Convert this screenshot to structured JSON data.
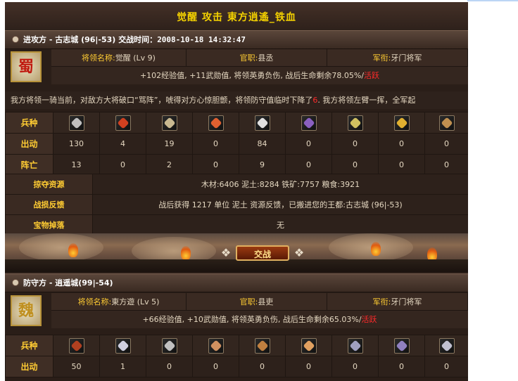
{
  "title": "觉醒 攻击 東方逍遙_铁血",
  "attacker": {
    "role": "进攻方",
    "city": "古志城 (96|-53)",
    "time_label": "交战时间：",
    "time": "2008-10-18 14:32:47",
    "general_label": "将领名称:",
    "general_name": "觉醒 (Lv 9)",
    "office_label": "官职:",
    "office": "县丞",
    "rank_label": "军衔:",
    "rank": "牙门将军",
    "avatar_glyph": "蜀",
    "result_text": "+102经验值, +11武勋值, 将领英勇负伤, 战后生命剩余78.05%/",
    "result_status": "活跃",
    "battle_text_1": "我方将领一骑当前，对敌方大将破口“骂阵”，唬得对方心惊胆颤，将领防守值临时下降了",
    "battle_text_red": "6",
    "battle_text_2": ". 我方将领左臂一挥，全军起",
    "units_label": "兵种",
    "sent_label": "出动",
    "lost_label": "阵亡",
    "sent": [
      "130",
      "4",
      "19",
      "0",
      "84",
      "0",
      "0",
      "0",
      "0"
    ],
    "lost": [
      "13",
      "0",
      "2",
      "0",
      "9",
      "0",
      "0",
      "0",
      "0"
    ],
    "loot_label": "掠夺资源",
    "loot": "木材:6406 泥土:8284 铁矿:7757 粮食:3921",
    "feedback_label": "战损反馈",
    "feedback": "战后获得 1217 单位 泥土 资源反馈，已搬进您的王都:古志城 (96|-53)",
    "treasure_label": "宝物掉落",
    "treasure": "无"
  },
  "fight_button": "交战",
  "defender": {
    "role": "防守方",
    "city": "逍遥城(99|-54)",
    "general_label": "将领名称:",
    "general_name": "東方遊 (Lv 5)",
    "office_label": "官职:",
    "office": "县吏",
    "rank_label": "军衔:",
    "rank": "牙门将军",
    "avatar_glyph": "魏",
    "result_text": "+66经验值, +10武勋值, 将领英勇负伤, 战后生命剩余65.03%/",
    "result_status": "活跃",
    "units_label": "兵种",
    "sent_label": "出动",
    "sent": [
      "50",
      "1",
      "0",
      "0",
      "0",
      "0",
      "0",
      "0",
      "0"
    ]
  },
  "colors": {
    "title": "#f5d200",
    "label": "#ffcc33",
    "text": "#e4d7c0",
    "status_red": "#ff2a2a",
    "panel_bg": "#2a1e18"
  },
  "unit_icons": [
    "axe-icon",
    "cavalry-icon",
    "archer-icon",
    "catapult-icon",
    "horse-icon",
    "spear-icon",
    "siege-icon",
    "scout-icon",
    "chariot-icon"
  ]
}
